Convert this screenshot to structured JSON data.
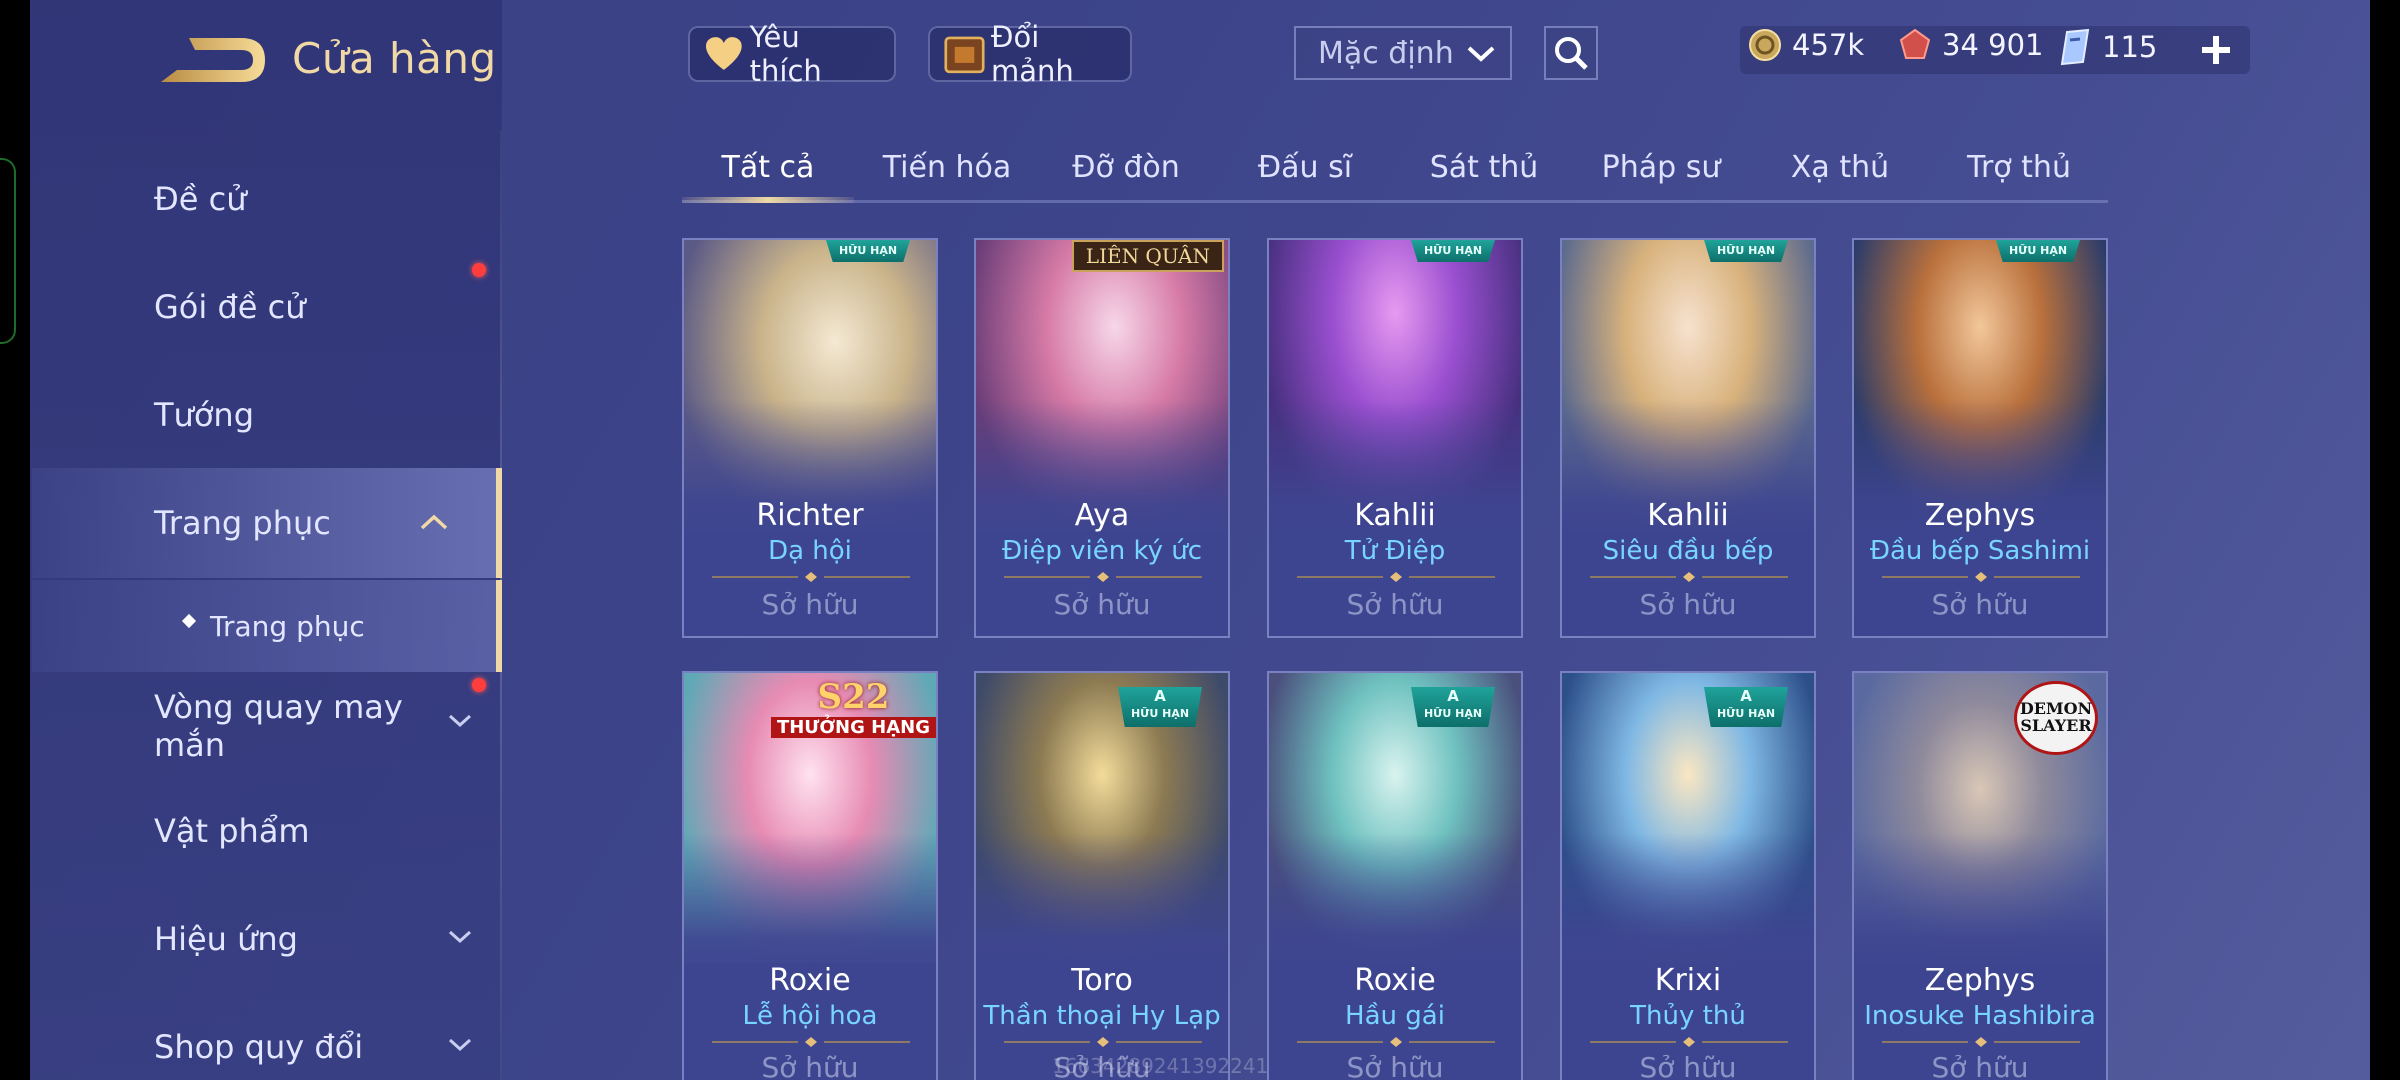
{
  "header": {
    "title": "Cửa hàng",
    "favorite_label": "Yêu thích",
    "shards_label": "Đổi mảnh",
    "sort_value": "Mặc định"
  },
  "currency": {
    "gold": "457k",
    "rubies": "34 901",
    "vouchers": "115"
  },
  "sidebar": {
    "items": [
      {
        "label": "Đề cử"
      },
      {
        "label": "Gói đề cử"
      },
      {
        "label": "Tướng"
      },
      {
        "label": "Trang phục"
      },
      {
        "label": "Trang phục"
      },
      {
        "label": "Vòng quay may mắn"
      },
      {
        "label": "Vật phẩm"
      },
      {
        "label": "Hiệu ứng"
      },
      {
        "label": "Shop quy đổi"
      }
    ]
  },
  "tabs": [
    "Tất cả",
    "Tiến hóa",
    "Đỡ đòn",
    "Đấu sĩ",
    "Sát thủ",
    "Pháp sư",
    "Xạ thủ",
    "Trợ thủ"
  ],
  "badges": {
    "limited": "HỮU HẠN",
    "rank_a": "A",
    "brand": "LIÊN QUÂN",
    "season": "S22",
    "season_sub": "THƯỞNG HẠNG",
    "collab": "DEMON SLAYER"
  },
  "cards": [
    {
      "hero": "Richter",
      "skin": "Dạ hội",
      "status": "Sở hữu"
    },
    {
      "hero": "Aya",
      "skin": "Điệp viên ký ức",
      "status": "Sở hữu"
    },
    {
      "hero": "Kahlii",
      "skin": "Tử Điệp",
      "status": "Sở hữu"
    },
    {
      "hero": "Kahlii",
      "skin": "Siêu đầu bếp",
      "status": "Sở hữu"
    },
    {
      "hero": "Zephys",
      "skin": "Đầu bếp Sashimi",
      "status": "Sở hữu"
    },
    {
      "hero": "Roxie",
      "skin": "Lễ hội hoa",
      "status": "Sở hữu"
    },
    {
      "hero": "Toro",
      "skin": "Thần thoại Hy Lạp",
      "status": "Sở hữu"
    },
    {
      "hero": "Roxie",
      "skin": "Hầu gái",
      "status": "Sở hữu"
    },
    {
      "hero": "Krixi",
      "skin": "Thủy thủ",
      "status": "Sở hữu"
    },
    {
      "hero": "Zephys",
      "skin": "Inosuke Hashibira",
      "status": "Sở hữu"
    }
  ],
  "watermark": "16634289241392241",
  "colors": {
    "accent_gold": "#f0d9a6",
    "skin_name": "#78d5ff",
    "owned": "#8e95c6",
    "badge": "#1fa39a",
    "notify": "#ff3d3d"
  }
}
